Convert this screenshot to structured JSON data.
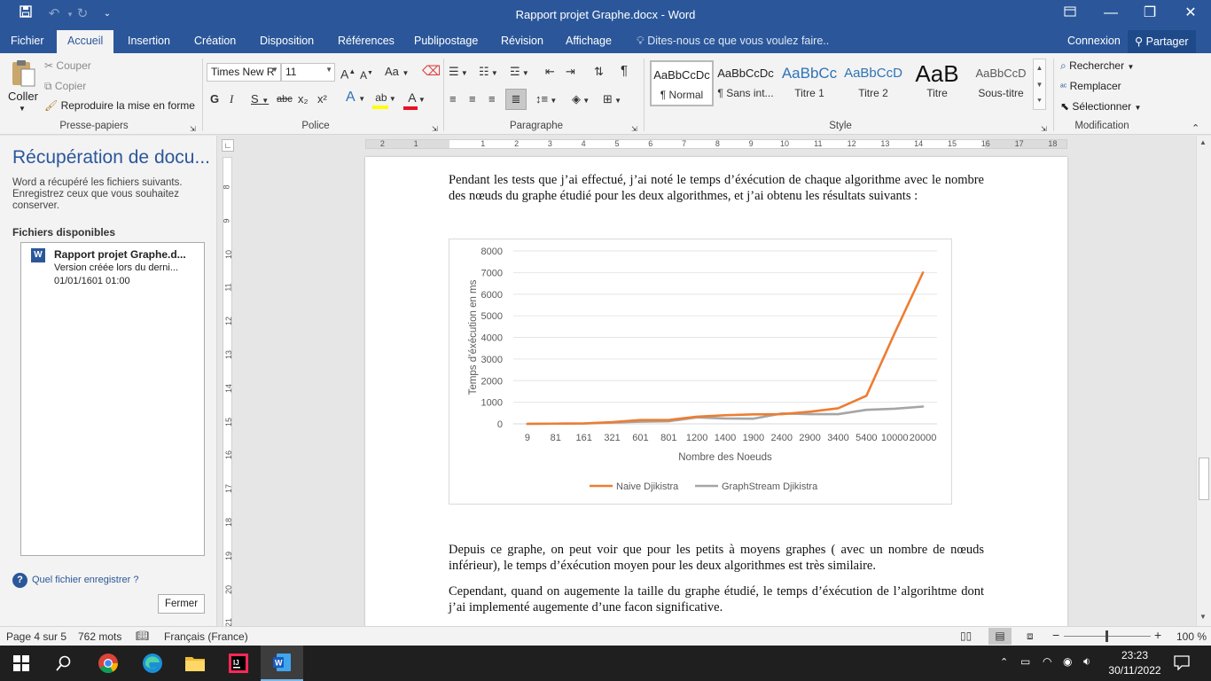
{
  "window": {
    "title": "Rapport projet Graphe.docx  -  Word",
    "save_icon": "save-icon",
    "undo_icon": "undo-icon",
    "redo_icon": "redo-icon",
    "customize_icon": "chevron-down-icon",
    "ribbon_display": "ribbon-display-icon",
    "minimize": "—",
    "maximize": "❐",
    "close": "✕"
  },
  "menu": {
    "tabs": [
      "Fichier",
      "Accueil",
      "Insertion",
      "Création",
      "Disposition",
      "Références",
      "Publipostage",
      "Révision",
      "Affichage"
    ],
    "tell_me": "Dites-nous ce que vous voulez faire..",
    "signin": "Connexion",
    "share": "Partager"
  },
  "ribbon": {
    "clipboard": {
      "paste": "Coller",
      "cut": "Couper",
      "copy": "Copier",
      "format_painter": "Reproduire la mise en forme",
      "label": "Presse-papiers"
    },
    "font": {
      "name": "Times New R",
      "size": "11",
      "bold": "G",
      "italic": "I",
      "underline": "S",
      "strike": "abc",
      "subscript": "x₂",
      "superscript": "x²",
      "grow": "A",
      "shrink": "A",
      "case": "Aa",
      "label": "Police",
      "text_color": "#e81123",
      "highlight_color": "#ffff00"
    },
    "paragraph": {
      "label": "Paragraphe",
      "pilcrow": "¶"
    },
    "styles": {
      "label": "Style",
      "items": [
        {
          "preview": "AaBbCcDc",
          "name": "¶ Normal",
          "color": "#222222"
        },
        {
          "preview": "AaBbCcDc",
          "name": "¶ Sans int...",
          "color": "#222222"
        },
        {
          "preview": "AaBbCc",
          "name": "Titre 1",
          "color": "#2e74b5"
        },
        {
          "preview": "AaBbCcD",
          "name": "Titre 2",
          "color": "#2e74b5"
        },
        {
          "preview": "AaB",
          "name": "Titre",
          "color": "#111111"
        },
        {
          "preview": "AaBbCcD",
          "name": "Sous-titre",
          "color": "#595959"
        }
      ]
    },
    "editing": {
      "find": "Rechercher",
      "replace": "Remplacer",
      "select": "Sélectionner",
      "label": "Modification"
    }
  },
  "pane": {
    "title": "Récupération de docu...",
    "description": "Word a récupéré les fichiers suivants. Enregistrez ceux que vous souhaitez conserver.",
    "available": "Fichiers disponibles",
    "file": {
      "name": "Rapport projet Graphe.d...",
      "version": "Version créée lors du derni...",
      "date": "01/01/1601 01:00"
    },
    "help": "Quel fichier enregistrer ?",
    "close": "Fermer"
  },
  "ruler": {
    "h_ticks": [
      "2",
      "1",
      "1",
      "2",
      "3",
      "4",
      "5",
      "6",
      "7",
      "8",
      "9",
      "10",
      "11",
      "12",
      "13",
      "14",
      "15",
      "16",
      "17",
      "18"
    ],
    "v_ticks": [
      "8",
      "9",
      "10",
      "11",
      "12",
      "13",
      "14",
      "15",
      "16",
      "17",
      "18",
      "19",
      "20",
      "21"
    ]
  },
  "document": {
    "para1": "Pendant les tests que j’ai effectué, j’ai noté le temps d’éxécution de chaque algorithme avec le nombre des nœuds du graphe étudié pour les deux algorithmes, et j’ai obtenu les résultats suivants :",
    "para2": "Depuis ce graphe, on peut voir que pour les petits à moyens graphes ( avec un nombre de nœuds inférieur), le temps d’éxécution moyen pour les deux algorithmes est très similaire.",
    "para3": "Cependant, quand on augemente la taille du graphe étudié, le temps d’éxécution de l’algorihtme dont j’ai implementé augemente d’une facon significative."
  },
  "chart_data": {
    "type": "line",
    "categories": [
      "9",
      "81",
      "161",
      "321",
      "601",
      "801",
      "1200",
      "1400",
      "1900",
      "2400",
      "2900",
      "3400",
      "5400",
      "10000",
      "20000"
    ],
    "series": [
      {
        "name": "Naive Djikistra",
        "color": "#ed7d31",
        "values": [
          0,
          10,
          20,
          80,
          180,
          180,
          330,
          400,
          440,
          450,
          560,
          720,
          1300,
          4200,
          7000
        ]
      },
      {
        "name": "GraphStream Djikistra",
        "color": "#a5a5a5",
        "values": [
          0,
          10,
          15,
          60,
          100,
          120,
          300,
          250,
          240,
          480,
          450,
          450,
          650,
          700,
          800
        ]
      }
    ],
    "xlabel": "Nombre des Noeuds",
    "ylabel": "Temps d’éxécution en ms",
    "ylim": [
      0,
      8000
    ],
    "yticks": [
      0,
      1000,
      2000,
      3000,
      4000,
      5000,
      6000,
      7000,
      8000
    ],
    "grid": true,
    "legend": "bottom"
  },
  "status": {
    "page": "Page 4 sur 5",
    "words": "762 mots",
    "proofing_icon": "proofing-icon",
    "language": "Français (France)",
    "zoom": "100 %"
  },
  "taskbar": {
    "time": "23:23",
    "date": "30/11/2022"
  }
}
